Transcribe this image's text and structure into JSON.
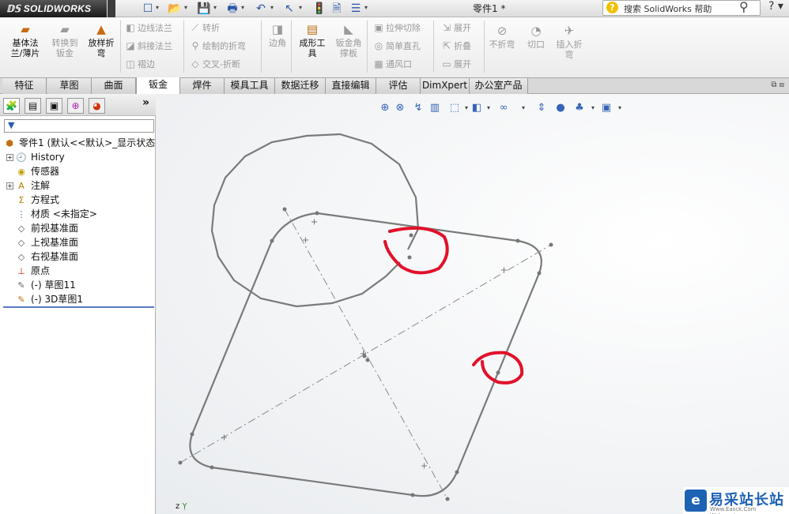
{
  "titlebar": {
    "logo_text": "SOLIDWORKS",
    "doc_title": "零件1 *",
    "search_placeholder": "搜索 SolidWorks 帮助",
    "help_label": "?",
    "quick_access": [
      {
        "name": "new-icon",
        "glyph": "☐"
      },
      {
        "name": "open-icon",
        "glyph": "📂"
      },
      {
        "name": "save-icon",
        "glyph": "💾"
      },
      {
        "name": "print-icon",
        "glyph": "🖶"
      },
      {
        "name": "undo-icon",
        "glyph": "↶"
      },
      {
        "name": "select-icon",
        "glyph": "↖"
      },
      {
        "name": "rebuild-icon",
        "glyph": "🚦"
      },
      {
        "name": "file-properties-icon",
        "glyph": "🗎"
      },
      {
        "name": "options-icon",
        "glyph": "☰"
      }
    ]
  },
  "ribbon": {
    "large_buttons": [
      {
        "name": "base-flange-button",
        "label": "基体法\n兰/薄片",
        "disabled": false,
        "icon": "▰",
        "color": "#c86a10"
      },
      {
        "name": "convert-to-sheet-metal-button",
        "label": "转换到\n钣金",
        "disabled": true,
        "icon": "▰",
        "color": "#9a9a9a"
      },
      {
        "name": "lofted-bend-button",
        "label": "放样折\n弯",
        "disabled": false,
        "icon": "▲",
        "color": "#c86a10"
      },
      {
        "name": "corners-button",
        "label": "边角",
        "disabled": true,
        "icon": "◨",
        "color": "#9a9a9a"
      },
      {
        "name": "forming-tool-button",
        "label": "成形工\n具",
        "disabled": false,
        "icon": "▤",
        "color": "#b86a10"
      },
      {
        "name": "sheet-metal-gusset-button",
        "label": "钣金角\n撑板",
        "disabled": true,
        "icon": "◣",
        "color": "#9a9a9a"
      },
      {
        "name": "no-bends-button",
        "label": "不折弯",
        "disabled": true,
        "icon": "⊘",
        "color": "#9a9a9a"
      },
      {
        "name": "rip-button",
        "label": "切口",
        "disabled": true,
        "icon": "◔",
        "color": "#9a9a9a"
      },
      {
        "name": "insert-bends-button",
        "label": "插入折\n弯",
        "disabled": true,
        "icon": "✈",
        "color": "#9a9a9a"
      }
    ],
    "small_buttons": [
      {
        "name": "edge-flange-button",
        "label": "边线法兰",
        "icon": "◧"
      },
      {
        "name": "miter-flange-button",
        "label": "斜接法兰",
        "icon": "◪"
      },
      {
        "name": "hem-button",
        "label": "褶边",
        "icon": "◫"
      },
      {
        "name": "jog-button",
        "label": "转折",
        "icon": "⟋"
      },
      {
        "name": "sketched-bend-button",
        "label": "绘制的折弯",
        "icon": "⚲"
      },
      {
        "name": "cross-break-button",
        "label": "交叉-折断",
        "icon": "◇"
      },
      {
        "name": "extruded-cut-button",
        "label": "拉伸切除",
        "icon": "▣"
      },
      {
        "name": "simple-hole-button",
        "label": "简单直孔",
        "icon": "◎"
      },
      {
        "name": "vent-button",
        "label": "通风口",
        "icon": "▦"
      },
      {
        "name": "unfold-button",
        "label": "展开",
        "icon": "⇲"
      },
      {
        "name": "fold-button",
        "label": "折叠",
        "icon": "⇱"
      },
      {
        "name": "flatten-button",
        "label": "展开",
        "icon": "▭"
      }
    ]
  },
  "tabs": [
    {
      "name": "tab-features",
      "label": "特征",
      "active": false
    },
    {
      "name": "tab-sketch",
      "label": "草图",
      "active": false
    },
    {
      "name": "tab-surfaces",
      "label": "曲面",
      "active": false
    },
    {
      "name": "tab-sheet-metal",
      "label": "钣金",
      "active": true
    },
    {
      "name": "tab-weldments",
      "label": "焊件",
      "active": false
    },
    {
      "name": "tab-mold-tools",
      "label": "模具工具",
      "active": false
    },
    {
      "name": "tab-data-migration",
      "label": "数据迁移",
      "active": false
    },
    {
      "name": "tab-direct-editing",
      "label": "直接编辑",
      "active": false
    },
    {
      "name": "tab-evaluate",
      "label": "评估",
      "active": false
    },
    {
      "name": "tab-dimxpert",
      "label": "DimXpert",
      "active": false
    },
    {
      "name": "tab-office-products",
      "label": "办公室产品",
      "active": false
    }
  ],
  "feature_manager": {
    "expand_label": "»",
    "root": "零件1 (默认<<默认>_显示状态 1",
    "items": [
      {
        "name": "tree-item-history",
        "label": "History",
        "icon": "🕘",
        "expandable": true
      },
      {
        "name": "tree-item-sensors",
        "label": "传感器",
        "icon": "◉",
        "expandable": false
      },
      {
        "name": "tree-item-annotations",
        "label": "注解",
        "icon": "A",
        "expandable": true
      },
      {
        "name": "tree-item-equations",
        "label": "方程式",
        "icon": "Σ",
        "expandable": false
      },
      {
        "name": "tree-item-material",
        "label": "材质 <未指定>",
        "icon": "⋮",
        "expandable": false
      },
      {
        "name": "tree-item-front-plane",
        "label": "前视基准面",
        "icon": "◇",
        "expandable": false
      },
      {
        "name": "tree-item-top-plane",
        "label": "上视基准面",
        "icon": "◇",
        "expandable": false
      },
      {
        "name": "tree-item-right-plane",
        "label": "右视基准面",
        "icon": "◇",
        "expandable": false
      },
      {
        "name": "tree-item-origin",
        "label": "原点",
        "icon": "⊥",
        "expandable": false
      },
      {
        "name": "tree-item-sketch11",
        "label": "(-) 草图11",
        "icon": "✎",
        "expandable": false
      },
      {
        "name": "tree-item-3dsketch1",
        "label": "(-) 3D草图1",
        "icon": "✎",
        "expandable": false
      }
    ]
  },
  "view_toolbar": [
    {
      "name": "zoom-to-fit-icon",
      "glyph": "⊕"
    },
    {
      "name": "zoom-to-area-icon",
      "glyph": "⊗"
    },
    {
      "name": "previous-view-icon",
      "glyph": "↯"
    },
    {
      "name": "section-view-icon",
      "glyph": "▥"
    },
    {
      "name": "view-orientation-icon",
      "glyph": "⬚"
    },
    {
      "name": "display-style-icon",
      "glyph": "◧"
    },
    {
      "name": "hide-show-items-icon",
      "glyph": "∞"
    },
    {
      "name": "view-axis-icon",
      "glyph": "⇕"
    },
    {
      "name": "edit-appearance-icon",
      "glyph": "●"
    },
    {
      "name": "apply-scene-icon",
      "glyph": "♣"
    },
    {
      "name": "view-settings-icon",
      "glyph": "▣"
    }
  ],
  "colors": {
    "sketch_line": "#7a7a7a",
    "annotation_red": "#e2102a",
    "accent_blue": "#1e62b4"
  },
  "watermark": {
    "logo": "e",
    "name": "易采站长站",
    "url": "Www.Easck.Com  Webmaster"
  },
  "origin_label": "z"
}
